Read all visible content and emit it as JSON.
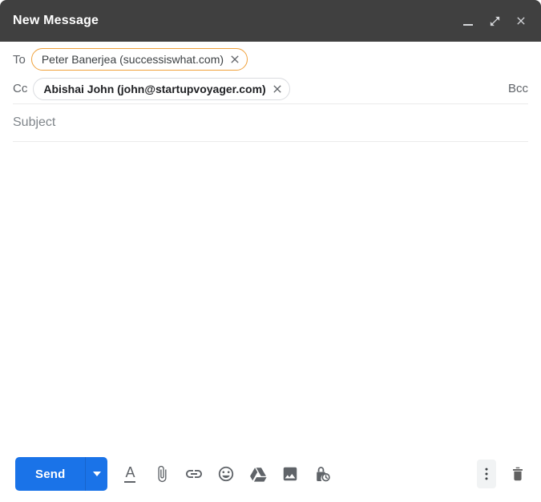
{
  "window": {
    "title": "New Message",
    "controls": [
      {
        "name": "minimize"
      },
      {
        "name": "pop-out"
      },
      {
        "name": "close"
      }
    ]
  },
  "recipients": {
    "to_label": "To",
    "to_chip_text": "Peter Banerjea (successiswhat.com)",
    "cc_label": "Cc",
    "cc_chip_text": "Abishai John (john@startupvoyager.com)",
    "bcc_label": "Bcc"
  },
  "subject_placeholder": "Subject",
  "body_text": "",
  "toolbar": {
    "send_label": "Send",
    "icon_names": [
      "formatting-options",
      "attach-files",
      "insert-link",
      "insert-emoji",
      "insert-from-drive",
      "insert-photo",
      "toggle-confidential-mode",
      "more-options",
      "discard-draft"
    ]
  },
  "colors": {
    "header_bg": "#404040",
    "send_blue": "#1a73e8",
    "focused_chip_border": "#f0a13b",
    "chip_border": "#dadce0",
    "icon_gray": "#5f6368",
    "divider": "#ebebeb"
  }
}
